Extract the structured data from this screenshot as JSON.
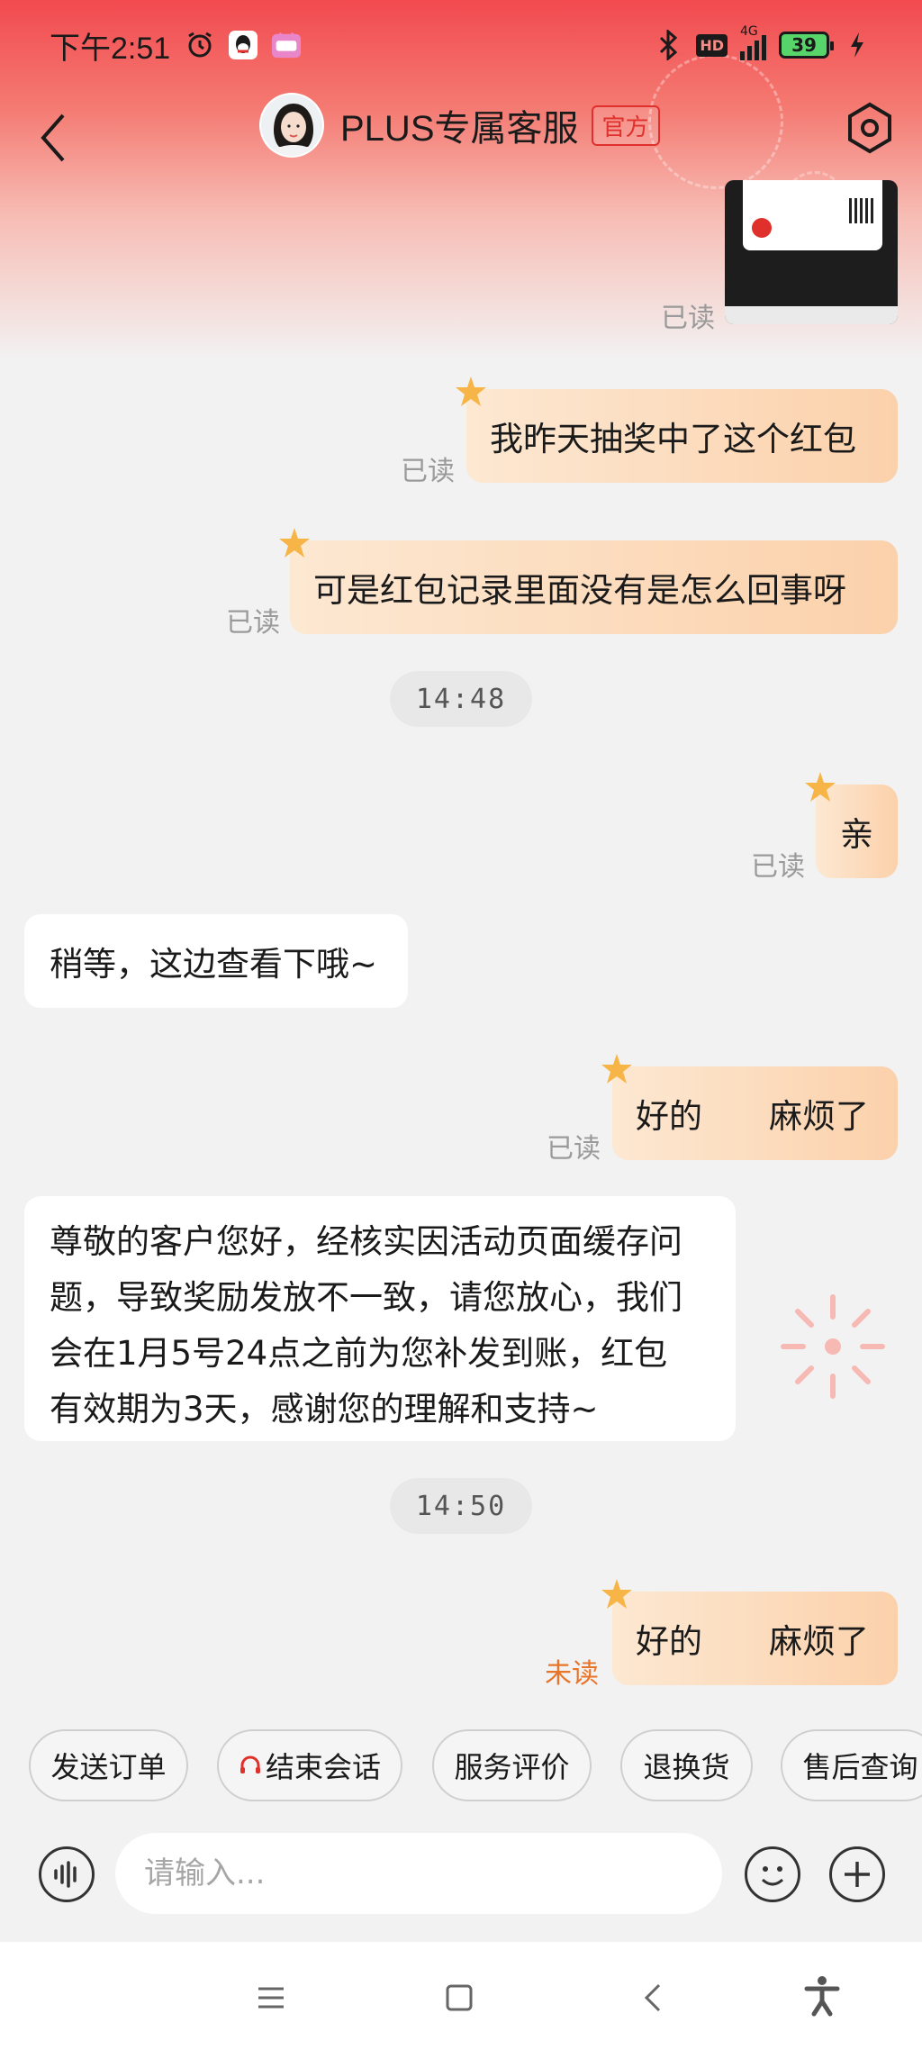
{
  "status_bar": {
    "time": "下午2:51",
    "network": "4G",
    "battery": "39",
    "hd": "HD"
  },
  "header": {
    "title": "PLUS专属客服",
    "official_tag": "官方"
  },
  "messages": [
    {
      "kind": "image",
      "sender": "me",
      "status": "已读"
    },
    {
      "kind": "text",
      "sender": "me",
      "text": "我昨天抽奖中了这个红包",
      "status": "已读"
    },
    {
      "kind": "text",
      "sender": "me",
      "text": "可是红包记录里面没有是怎么回事呀",
      "status": "已读"
    },
    {
      "kind": "time",
      "text": "14:48"
    },
    {
      "kind": "text",
      "sender": "me",
      "text": "亲",
      "status": "已读"
    },
    {
      "kind": "text",
      "sender": "agent",
      "text": "稍等，这边查看下哦~"
    },
    {
      "kind": "text",
      "sender": "me",
      "text": "好的　　麻烦了",
      "status": "已读"
    },
    {
      "kind": "text",
      "sender": "agent",
      "lines": [
        "尊敬的客户您好，经核实因活动页面缓存问",
        "题，导致奖励发放不一致，请您放心，我们",
        "会在1月5号24点之前为您补发到账，红包",
        "有效期为3天，感谢您的理解和支持~"
      ]
    },
    {
      "kind": "time",
      "text": "14:50"
    },
    {
      "kind": "text",
      "sender": "me",
      "text": "好的　　麻烦了",
      "status": "未读"
    }
  ],
  "quick_actions": [
    "发送订单",
    "结束会话",
    "服务评价",
    "退换货",
    "售后查询"
  ],
  "input": {
    "placeholder": "请输入..."
  },
  "colors": {
    "brand_red": "#e0302c",
    "bubble_out": "#fbd1ab",
    "unread": "#e8742a"
  }
}
